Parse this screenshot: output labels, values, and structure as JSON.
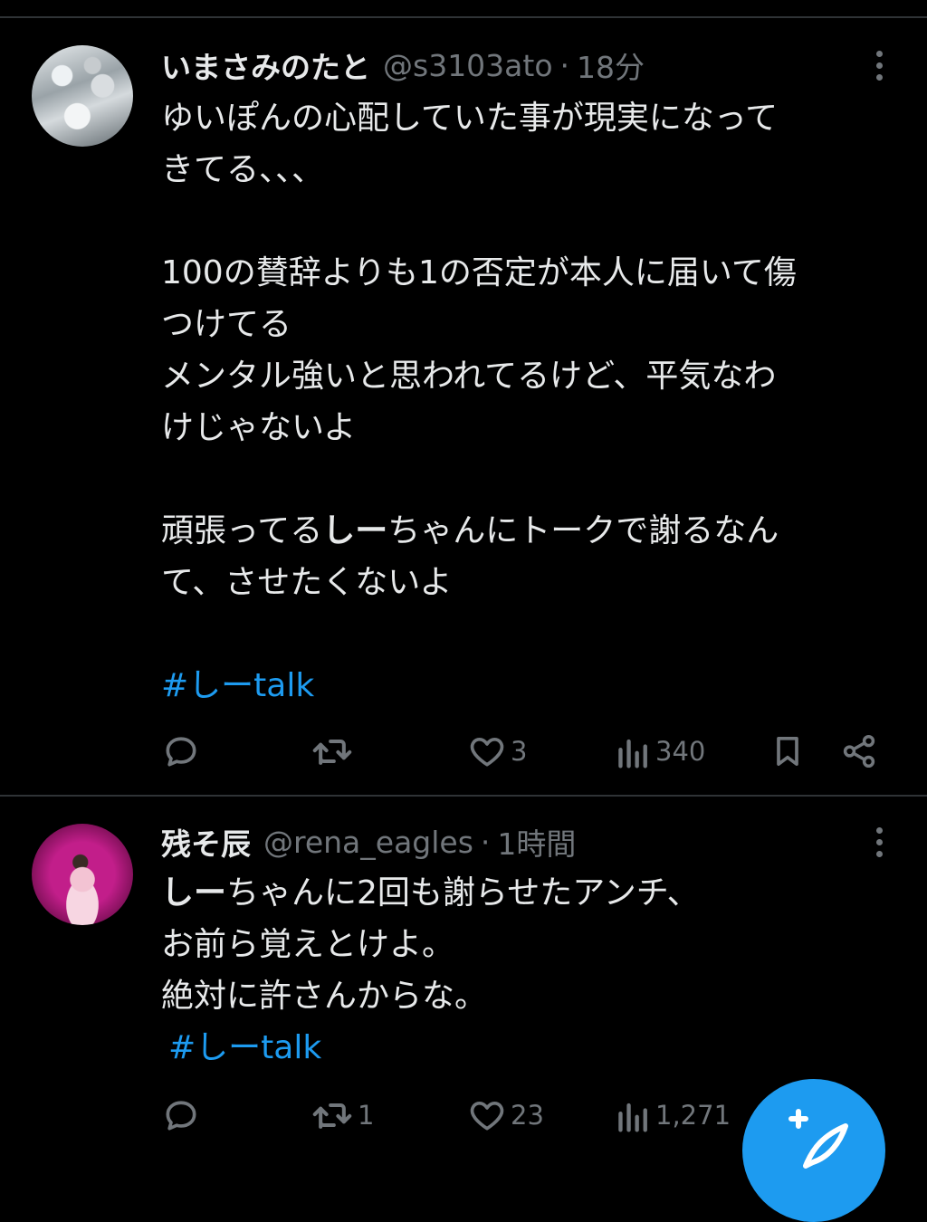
{
  "tweets": [
    {
      "name": "いまさみのたと",
      "handle": "@s3103ato",
      "separator": "·",
      "time": "18分",
      "lines": [
        "ゆいぽんの心配していた事が現実になって",
        "きてる、、、",
        "",
        "100の賛辞よりも1の否定が本人に届いて傷",
        "つけてる",
        "メンタル強いと思われてるけど、平気なわ",
        "けじゃないよ",
        "",
        "頑張ってる",
        "て、させたくないよ",
        ""
      ],
      "bold_part": "しー",
      "line9_rest": "ちゃんにトークで謝るなん",
      "hashtag": "#しーtalk",
      "reply_count": "",
      "retweet_count": "",
      "like_count": "3",
      "view_count": "340"
    },
    {
      "name": "残そ辰",
      "handle": "@rena_eagles",
      "separator": "·",
      "time": "1時間",
      "bold_part": "しー",
      "line1_rest": "ちゃんに2回も謝らせたアンチ、",
      "line2": "お前ら覚えとけよ。",
      "line3": "絶対に許さんからな。",
      "hashtag": "#しーtalk",
      "reply_count": "",
      "retweet_count": "1",
      "like_count": "23",
      "view_count": "1,271"
    }
  ],
  "icons": {
    "reply": "reply-icon",
    "retweet": "retweet-icon",
    "like": "heart-icon",
    "views": "views-icon",
    "bookmark": "bookmark-icon",
    "share": "share-icon",
    "more": "more-icon",
    "compose": "compose-icon"
  },
  "colors": {
    "background": "#000000",
    "text": "#e7e9ea",
    "muted": "#71767b",
    "accent": "#1d9bf0"
  }
}
